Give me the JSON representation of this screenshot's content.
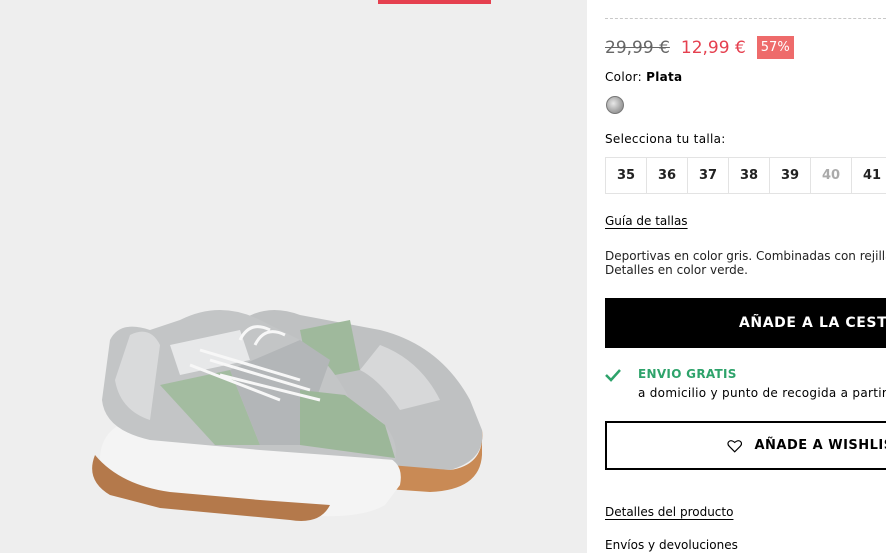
{
  "product": {
    "old_price": "29,99 €",
    "new_price": "12,99 €",
    "discount": "57%",
    "color_label": "Color:",
    "color_value": "Plata",
    "color_swatch": "silver",
    "size_label": "Selecciona tu talla:",
    "sizes": [
      {
        "label": "35",
        "available": true
      },
      {
        "label": "36",
        "available": true
      },
      {
        "label": "37",
        "available": true
      },
      {
        "label": "38",
        "available": true
      },
      {
        "label": "39",
        "available": true
      },
      {
        "label": "40",
        "available": false
      },
      {
        "label": "41",
        "available": true,
        "badge": true
      }
    ],
    "size_guide": "Guía de tallas",
    "description_line1": "Deportivas en color gris. Combinadas con rejilla y",
    "description_line2": "Detalles en color verde."
  },
  "actions": {
    "add_to_cart": "AÑADE A LA CESTA",
    "add_to_wishlist": "AÑADE A WISHLIST"
  },
  "shipping": {
    "title": "ENVIO GRATIS",
    "text": "a domicilio y punto de recogida a partir d"
  },
  "links": {
    "product_details": "Detalles del producto",
    "shipping_returns": "Envíos y devoluciones"
  },
  "colors": {
    "accent": "#e5404f",
    "discount_bg": "#ee6b6b",
    "success": "#2ea36b",
    "gallery_bg": "#eeeeee"
  },
  "icons": {
    "check": "check-icon",
    "heart": "heart-icon"
  }
}
